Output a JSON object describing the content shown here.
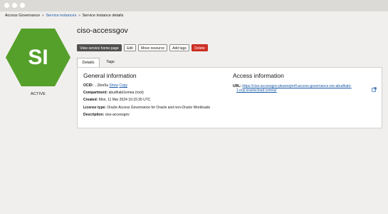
{
  "breadcrumb": {
    "root": "Access Governance",
    "separator": "»",
    "instances": "Service instances",
    "current": "Service instance details"
  },
  "avatar": {
    "initials": "SI",
    "color": "#55a02b"
  },
  "status": "ACTIVE",
  "title": "ciso-accessgov",
  "toolbar": {
    "view_home": "View service home page",
    "edit": "Edit",
    "move": "Move resource",
    "add_tags": "Add tags",
    "delete": "Delete"
  },
  "tabs": [
    {
      "label": "Details",
      "active": true
    },
    {
      "label": "Tags",
      "active": false
    }
  ],
  "general": {
    "heading": "General information",
    "ocid_label": "OCID:",
    "ocid_value": "...2kre5a",
    "show": "Show",
    "copy": "Copy",
    "compartment_label": "Compartment:",
    "compartment_value": "abudhabi1emea (root)",
    "created_label": "Created:",
    "created_value": "Mon, 11 Mar 2024 16:15:35 UTC",
    "license_label": "License type:",
    "license_value": "Oracle Access Governance for Oracle and non-Oracle Workloads",
    "description_label": "Description:",
    "description_value": "ciso-accessgov"
  },
  "access": {
    "heading": "Access information",
    "url_label": "URL:",
    "url_line1": "https://ciso-accessgov-pkuwrojmrfl.access-governance.me-abudhabi-",
    "url_line2": "1.ocp.oraclecloud.com/ui/"
  },
  "colors": {
    "accent_link": "#1a5aa6",
    "delete_button": "#d03025",
    "primary_button": "#505050"
  }
}
